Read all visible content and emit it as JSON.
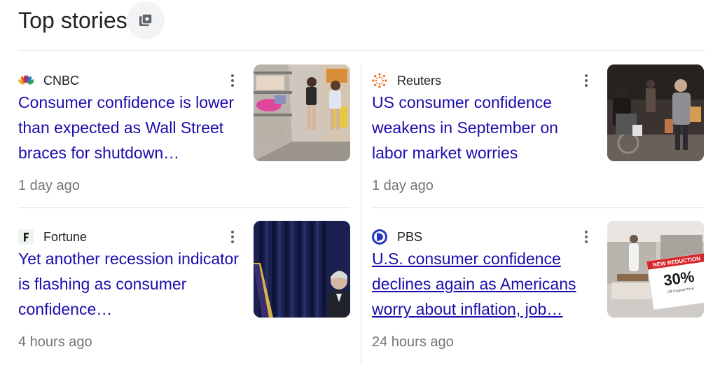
{
  "header": {
    "title": "Top stories",
    "icon": "save-stories-icon"
  },
  "stories": [
    {
      "source": "CNBC",
      "headline": "Consumer confidence is lower than expected as Wall Street braces for shutdown…",
      "time": "1 day ago",
      "thumbnail": "store-aisle-shoppers"
    },
    {
      "source": "Reuters",
      "headline": "US consumer confidence weakens in September on labor market worries",
      "time": "1 day ago",
      "thumbnail": "street-shoppers"
    },
    {
      "source": "Fortune",
      "headline": "Yet another recession indicator is flashing as consumer confidence…",
      "time": "4 hours ago",
      "thumbnail": "speaker-blue-curtain"
    },
    {
      "source": "PBS",
      "headline": "U.S. consumer confidence declines again as Americans worry about inflation, job…",
      "time": "24 hours ago",
      "thumbnail": "store-sale-sign"
    }
  ],
  "thumbnail_sign": {
    "line1": "NEW REDUCTION",
    "line2": "30%",
    "line3": "Off Original Price"
  },
  "colors": {
    "link": "#1a0dab",
    "meta": "#70757a",
    "divider": "#dadce0"
  }
}
